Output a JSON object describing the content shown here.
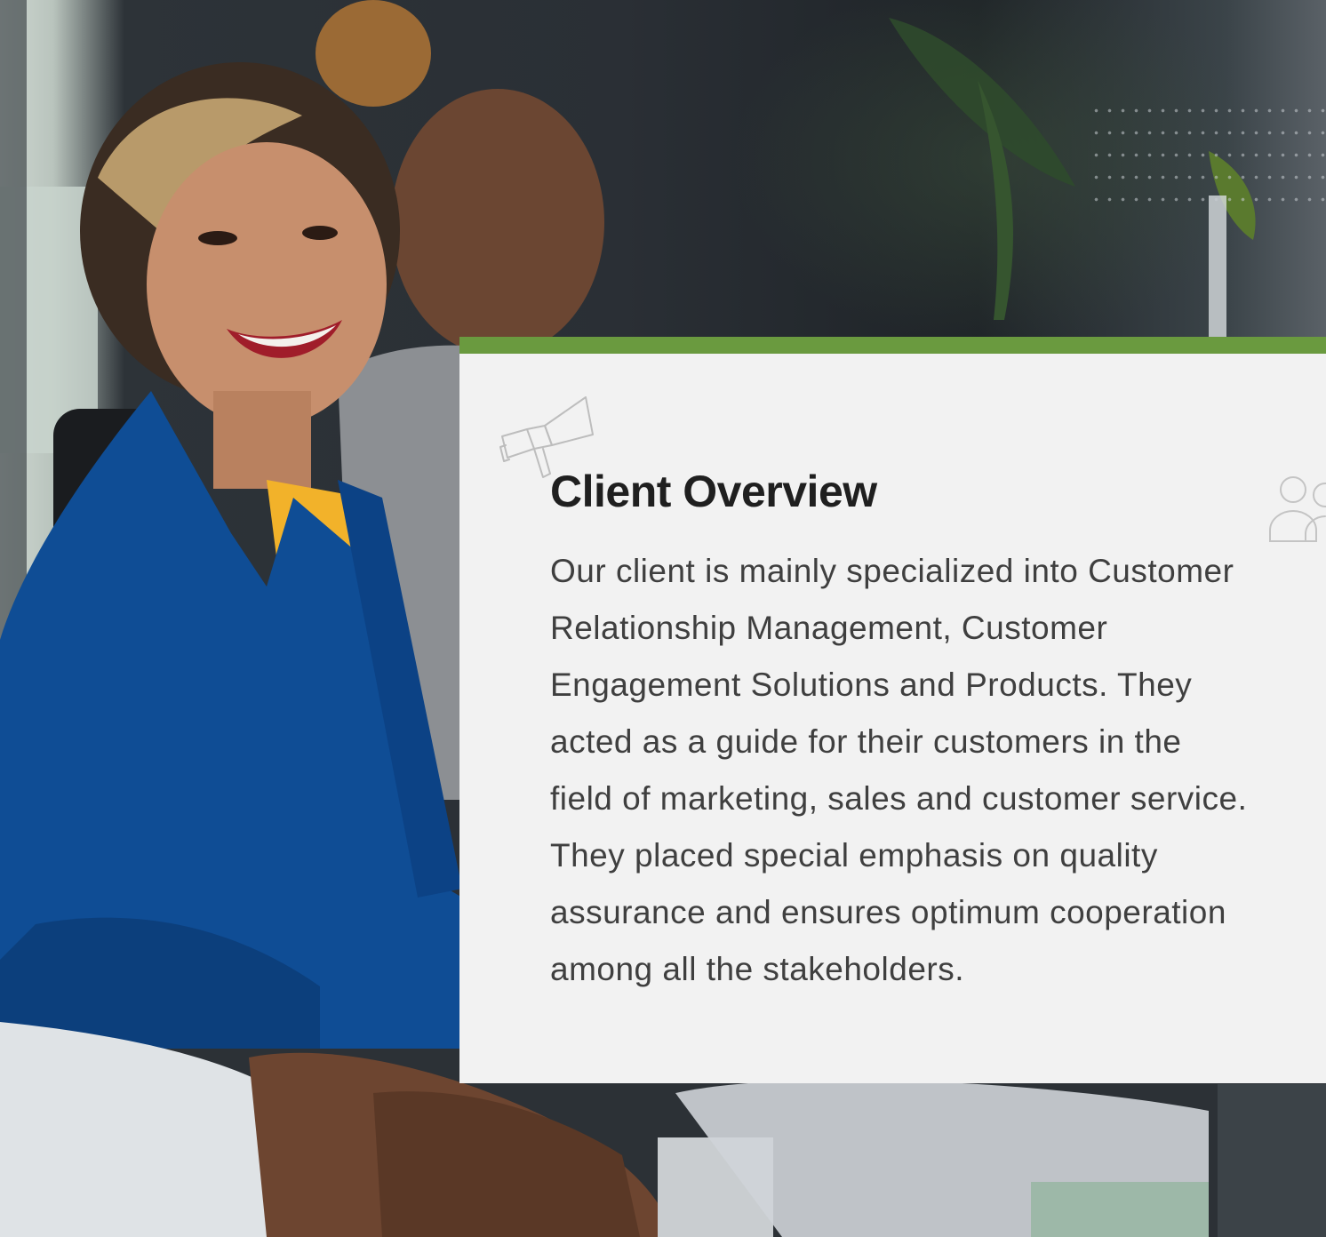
{
  "card": {
    "title": "Client Overview",
    "body_lines": [
      "Our client is mainly specialized into Customer",
      "Relationship Management, Customer",
      "Engagement Solutions and Products. They",
      "acted as a guide for their customers in the",
      "field of marketing, sales and customer service.",
      "They placed special emphasis on quality",
      "assurance and ensures optimum cooperation",
      "among all the stakeholders."
    ]
  },
  "colors": {
    "accent": "#6a9a3f",
    "card_background": "#f2f2f2",
    "title": "#1f1f1f",
    "body": "#3f3f3f"
  },
  "icons": {
    "decor_top_left": "megaphone-icon",
    "decor_right": "people-icon"
  }
}
